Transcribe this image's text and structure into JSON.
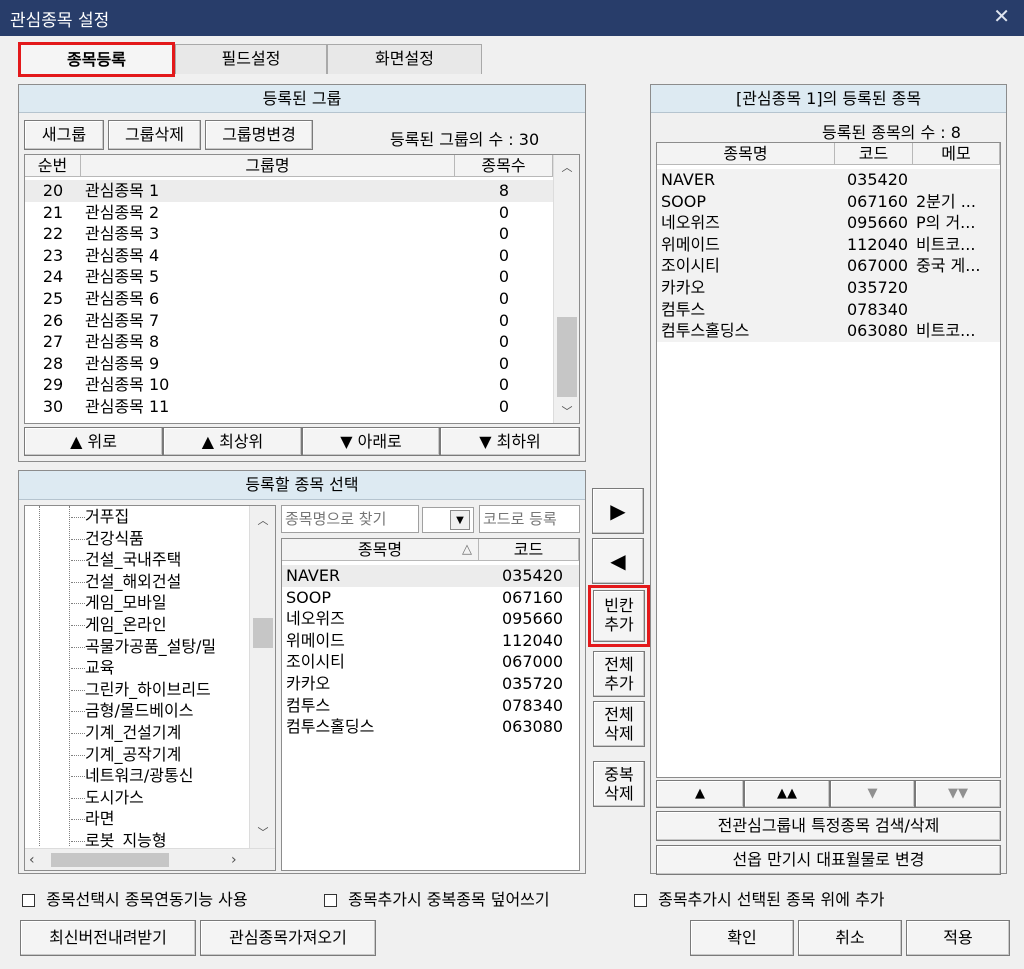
{
  "window": {
    "title": "관심종목 설정",
    "close_glyph": "✕"
  },
  "tabs": [
    "종목등록",
    "필드설정",
    "화면설정"
  ],
  "groups": {
    "header": "등록된 그룹",
    "buttons": {
      "new": "새그룹",
      "delete": "그룹삭제",
      "rename": "그룹명변경"
    },
    "count_text": "등록된 그룹의 수 : 30",
    "columns": {
      "seq": "순번",
      "name": "그룹명",
      "count": "종목수"
    },
    "rows": [
      {
        "seq": "20",
        "name": "관심종목 1",
        "count": "8"
      },
      {
        "seq": "21",
        "name": "관심종목 2",
        "count": "0"
      },
      {
        "seq": "22",
        "name": "관심종목 3",
        "count": "0"
      },
      {
        "seq": "23",
        "name": "관심종목 4",
        "count": "0"
      },
      {
        "seq": "24",
        "name": "관심종목 5",
        "count": "0"
      },
      {
        "seq": "25",
        "name": "관심종목 6",
        "count": "0"
      },
      {
        "seq": "26",
        "name": "관심종목 7",
        "count": "0"
      },
      {
        "seq": "27",
        "name": "관심종목 8",
        "count": "0"
      },
      {
        "seq": "28",
        "name": "관심종목 9",
        "count": "0"
      },
      {
        "seq": "29",
        "name": "관심종목 10",
        "count": "0"
      },
      {
        "seq": "30",
        "name": "관심종목 11",
        "count": "0"
      }
    ],
    "move": {
      "up": "▲ 위로",
      "top": "▲ 최상위",
      "down": "▼ 아래로",
      "bottom": "▼ 최하위"
    }
  },
  "select": {
    "header": "등록할 종목 선택",
    "tree": [
      "거푸집",
      "건강식품",
      "건설_국내주택",
      "건설_해외건설",
      "게임_모바일",
      "게임_온라인",
      "곡물가공품_설탕/밀",
      "교육",
      "그린카_하이브리드",
      "금형/몰드베이스",
      "기계_건설기계",
      "기계_공작기계",
      "네트워크/광통신",
      "도시가스",
      "라면",
      "로봇_지능형"
    ],
    "name_search_placeholder": "종목명으로 찾기",
    "code_search_placeholder": "코드로 등록",
    "columns": {
      "name": "종목명",
      "sort": "△",
      "code": "코드"
    },
    "stocks": [
      {
        "name": "NAVER",
        "code": "035420"
      },
      {
        "name": "SOOP",
        "code": "067160"
      },
      {
        "name": "네오위즈",
        "code": "095660"
      },
      {
        "name": "위메이드",
        "code": "112040"
      },
      {
        "name": "조이시티",
        "code": "067000"
      },
      {
        "name": "카카오",
        "code": "035720"
      },
      {
        "name": "컴투스",
        "code": "078340"
      },
      {
        "name": "컴투스홀딩스",
        "code": "063080"
      }
    ]
  },
  "middle": {
    "add": "▶",
    "remove": "◀",
    "blank_add": [
      "빈칸",
      "추가"
    ],
    "all_add": [
      "전체",
      "추가"
    ],
    "all_delete": [
      "전체",
      "삭제"
    ],
    "dup_delete": [
      "중복",
      "삭제"
    ]
  },
  "registered": {
    "header": "[관심종목 1]의 등록된 종목",
    "count_text": "등록된 종목의 수 : 8",
    "columns": {
      "name": "종목명",
      "code": "코드",
      "memo": "메모"
    },
    "rows": [
      {
        "name": "NAVER",
        "code": "035420",
        "memo": ""
      },
      {
        "name": "SOOP",
        "code": "067160",
        "memo": "2분기 ..."
      },
      {
        "name": "네오위즈",
        "code": "095660",
        "memo": "P의 거..."
      },
      {
        "name": "위메이드",
        "code": "112040",
        "memo": "비트코..."
      },
      {
        "name": "조이시티",
        "code": "067000",
        "memo": "중국 게..."
      },
      {
        "name": "카카오",
        "code": "035720",
        "memo": ""
      },
      {
        "name": "컴투스",
        "code": "078340",
        "memo": ""
      },
      {
        "name": "컴투스홀딩스",
        "code": "063080",
        "memo": "비트코..."
      }
    ],
    "move": [
      "▲",
      "▲▲",
      "▼",
      "▼▼"
    ],
    "search_delete": "전관심그룹내 특정종목 검색/삭제",
    "option_change": "선옵 만기시 대표월물로 변경"
  },
  "checkboxes": [
    "종목선택시 종목연동기능 사용",
    "종목추가시 중복종목 덮어쓰기",
    "종목추가시 선택된 종목 위에 추가"
  ],
  "bottom": {
    "download": "최신버전내려받기",
    "import": "관심종목가져오기",
    "ok": "확인",
    "cancel": "취소",
    "apply": "적용"
  },
  "colors": {
    "titlebar": "#283d6a",
    "panel_header": "#ddeaf2",
    "highlight": "#e3191b"
  }
}
